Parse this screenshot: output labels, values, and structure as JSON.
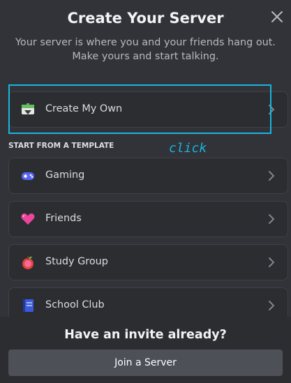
{
  "header": {
    "title": "Create Your Server",
    "subtitle": "Your server is where you and your friends hang out. Make yours and start talking."
  },
  "options": {
    "create_own": {
      "label": "Create My Own",
      "icon": "create-server-icon"
    },
    "section_title": "START FROM A TEMPLATE",
    "templates": [
      {
        "label": "Gaming",
        "icon": "gamepad-icon"
      },
      {
        "label": "Friends",
        "icon": "heart-icon"
      },
      {
        "label": "Study Group",
        "icon": "apple-icon"
      },
      {
        "label": "School Club",
        "icon": "book-icon"
      }
    ]
  },
  "annotation": {
    "text": "click",
    "color": "#19b5e0"
  },
  "footer": {
    "title": "Have an invite already?",
    "join_label": "Join a Server"
  },
  "colors": {
    "background": "#313338",
    "card": "#2b2d31",
    "button": "#4e5058",
    "highlight": "#19b5e0"
  }
}
